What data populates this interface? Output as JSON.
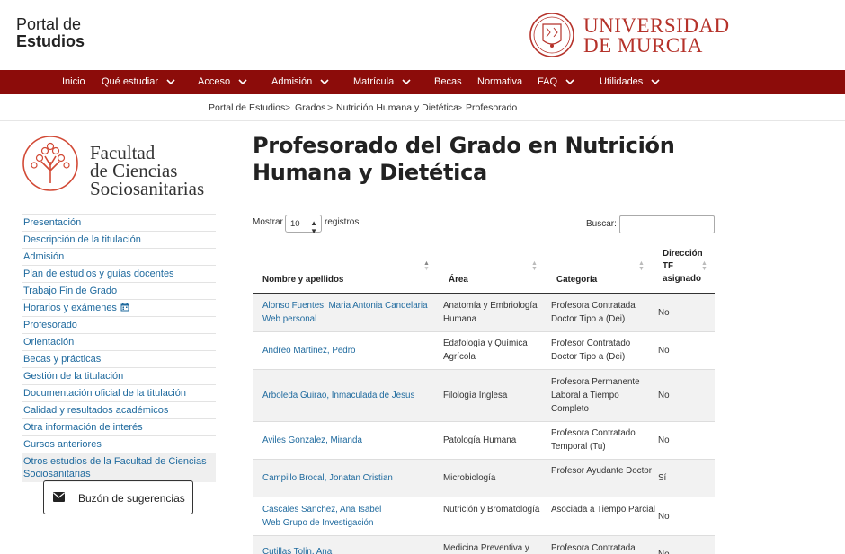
{
  "header": {
    "portal_line1": "Portal de",
    "portal_line2": "Estudios",
    "university_line1": "UNIVERSIDAD",
    "university_line2": "DE MURCIA"
  },
  "nav": [
    {
      "label": "Inicio",
      "dropdown": false
    },
    {
      "label": "Qué estudiar",
      "dropdown": true
    },
    {
      "label": "Acceso",
      "dropdown": true
    },
    {
      "label": "Admisión",
      "dropdown": true
    },
    {
      "label": "Matrícula",
      "dropdown": true
    },
    {
      "label": "Becas",
      "dropdown": false
    },
    {
      "label": "Normativa",
      "dropdown": false
    },
    {
      "label": "FAQ",
      "dropdown": true
    },
    {
      "label": "Utilidades",
      "dropdown": true
    }
  ],
  "breadcrumb": [
    "Portal de Estudios",
    "Grados",
    "Nutrición Humana y Dietética",
    "Profesorado"
  ],
  "faculty": {
    "line1": "Facultad",
    "line2": "de Ciencias",
    "line3": "Sociosanitarias"
  },
  "sidebar": [
    {
      "label": "Presentación"
    },
    {
      "label": "Descripción de la titulación"
    },
    {
      "label": "Admisión"
    },
    {
      "label": "Plan de estudios y guías docentes"
    },
    {
      "label": "Trabajo Fin de Grado"
    },
    {
      "label": "Horarios y exámenes",
      "icon": "calendar-icon"
    },
    {
      "label": "Profesorado"
    },
    {
      "label": "Orientación"
    },
    {
      "label": "Becas y prácticas"
    },
    {
      "label": "Gestión de la titulación"
    },
    {
      "label": "Documentación oficial de la titulación"
    },
    {
      "label": "Calidad y resultados académicos"
    },
    {
      "label": "Otra información de interés"
    },
    {
      "label": "Cursos anteriores"
    },
    {
      "label": "Otros estudios de la Facultad de Ciencias Sociosanitarias",
      "active": true
    }
  ],
  "suggestions_button": "Buzón de sugerencias",
  "main": {
    "title": "Profesorado del Grado en Nutrición Humana y Dietética",
    "show_label": "Mostrar",
    "show_value": "10",
    "records_label": "registros",
    "search_label": "Buscar:",
    "search_value": ""
  },
  "table": {
    "headers": {
      "name": "Nombre y apellidos",
      "area": "Área",
      "category": "Categoría",
      "tf": "Dirección TF asignado"
    },
    "rows": [
      {
        "name": "Alonso Fuentes, Maria Antonia Candelaria",
        "link2": "Web personal",
        "area": "Anatomía y Embriología Humana",
        "category": "Profesora Contratada Doctor Tipo a (Dei)",
        "tf": "No"
      },
      {
        "name": "Andreo Martinez, Pedro",
        "link2": "",
        "area": "Edafología y Química Agrícola",
        "category": "Profesor Contratado Doctor Tipo a (Dei)",
        "tf": "No"
      },
      {
        "name": "Arboleda Guirao, Inmaculada de Jesus",
        "link2": "",
        "area": "Filología Inglesa",
        "category": "Profesora Permanente Laboral a Tiempo Completo",
        "tf": "No"
      },
      {
        "name": "Aviles Gonzalez, Miranda",
        "link2": "",
        "area": "Patología Humana",
        "category": "Profesora Contratado Temporal (Tu)",
        "tf": "No"
      },
      {
        "name": "Campillo Brocal, Jonatan Cristian",
        "link2": "",
        "area": "Microbiología",
        "category": "Profesor Ayudante Doctor",
        "tf": "Sí"
      },
      {
        "name": "Cascales Sanchez, Ana Isabel",
        "link2": "Web Grupo de Investigación",
        "area": "Nutrición y Bromatología",
        "category": "Asociada a Tiempo Parcial",
        "tf": "No"
      },
      {
        "name": "Cutillas Tolin, Ana",
        "link2": "",
        "area": "Medicina Preventiva y Salud Pública",
        "category": "Profesora Contratada",
        "tf": "No"
      }
    ]
  },
  "colors": {
    "brand_red": "#8c0c0a",
    "logo_red": "#b5322a",
    "link_blue": "#1f6a9e"
  }
}
